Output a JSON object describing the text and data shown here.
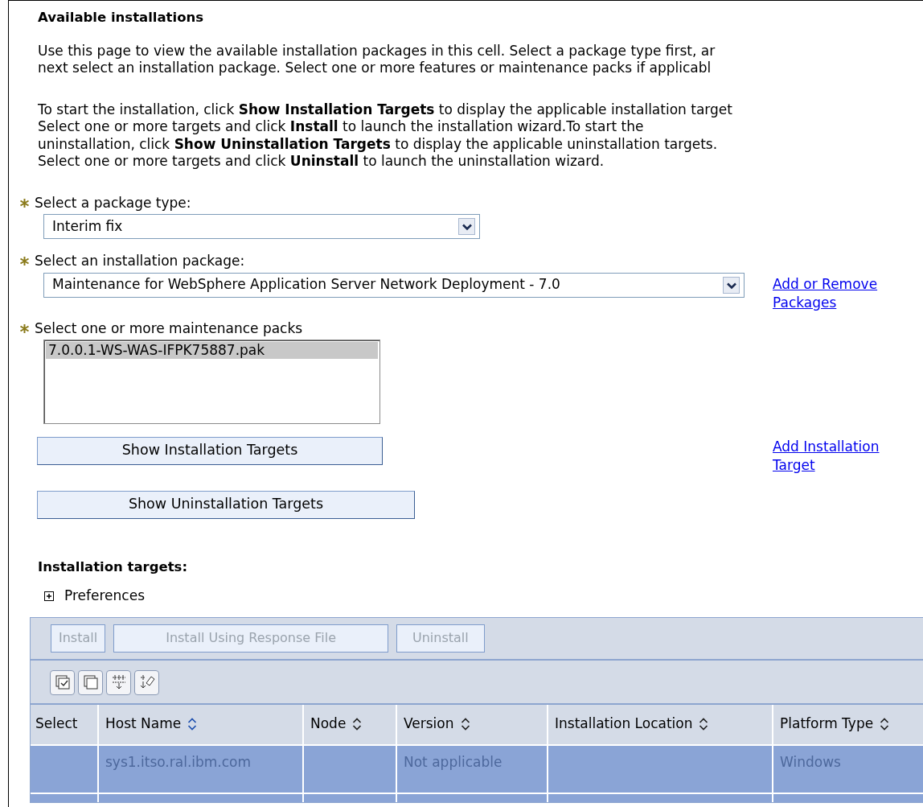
{
  "title": "Available installations",
  "intro": {
    "lines": [
      "Use this page to view the available installation packages in this cell. Select a package type first, ar",
      "next select an installation package. Select one or more features or maintenance packs if applicabl"
    ]
  },
  "instructions": {
    "lines": [
      "To start the installation, click **Show Installation Targets** to display the applicable installation target",
      "Select one or more targets and click **Install** to launch the installation wizard.To start the",
      "uninstallation, click **Show Uninstallation Targets** to display the applicable uninstallation targets.",
      "Select one or more targets and click **Uninstall** to launch the uninstallation wizard."
    ]
  },
  "package_type": {
    "label": "Select a package type:",
    "required": true,
    "value": "Interim fix"
  },
  "installation_package": {
    "label": "Select an installation package:",
    "required": true,
    "value": "Maintenance for WebSphere Application Server Network Deployment - 7.0",
    "link": "Add or Remove Packages"
  },
  "maintenance_packs": {
    "label": "Select one or more maintenance packs",
    "required": true,
    "items": [
      {
        "label": "7.0.0.1-WS-WAS-IFPK75887.pak",
        "selected": true
      }
    ]
  },
  "show_installation_targets": {
    "label": "Show Installation Targets",
    "link": "Add Installation Target"
  },
  "show_uninstallation_targets": {
    "label": "Show Uninstallation Targets"
  },
  "installation_targets": {
    "title": "Installation targets:",
    "preferences": {
      "label": "Preferences",
      "expanded": false
    },
    "actions": [
      {
        "label": "Install",
        "disabled": true
      },
      {
        "label": "Install Using Response File",
        "disabled": true
      },
      {
        "label": "Uninstall",
        "disabled": true
      }
    ],
    "tools": [
      {
        "kind": "select-all"
      },
      {
        "kind": "deselect-all"
      },
      {
        "kind": "filter"
      },
      {
        "kind": "clear-filter"
      }
    ],
    "columns": [
      {
        "label": "Select"
      },
      {
        "label": "Host Name",
        "sorted": true
      },
      {
        "label": "Node",
        "sorted": false
      },
      {
        "label": "Version",
        "sorted": false
      },
      {
        "label": "Installation Location",
        "sorted": false
      },
      {
        "label": "Platform Type",
        "sorted": false
      }
    ],
    "rows": [
      {
        "selected": true,
        "cells": [
          "",
          "sys1.itso.ral.ibm.com",
          "",
          "Not applicable",
          "",
          "Windows"
        ]
      }
    ]
  }
}
